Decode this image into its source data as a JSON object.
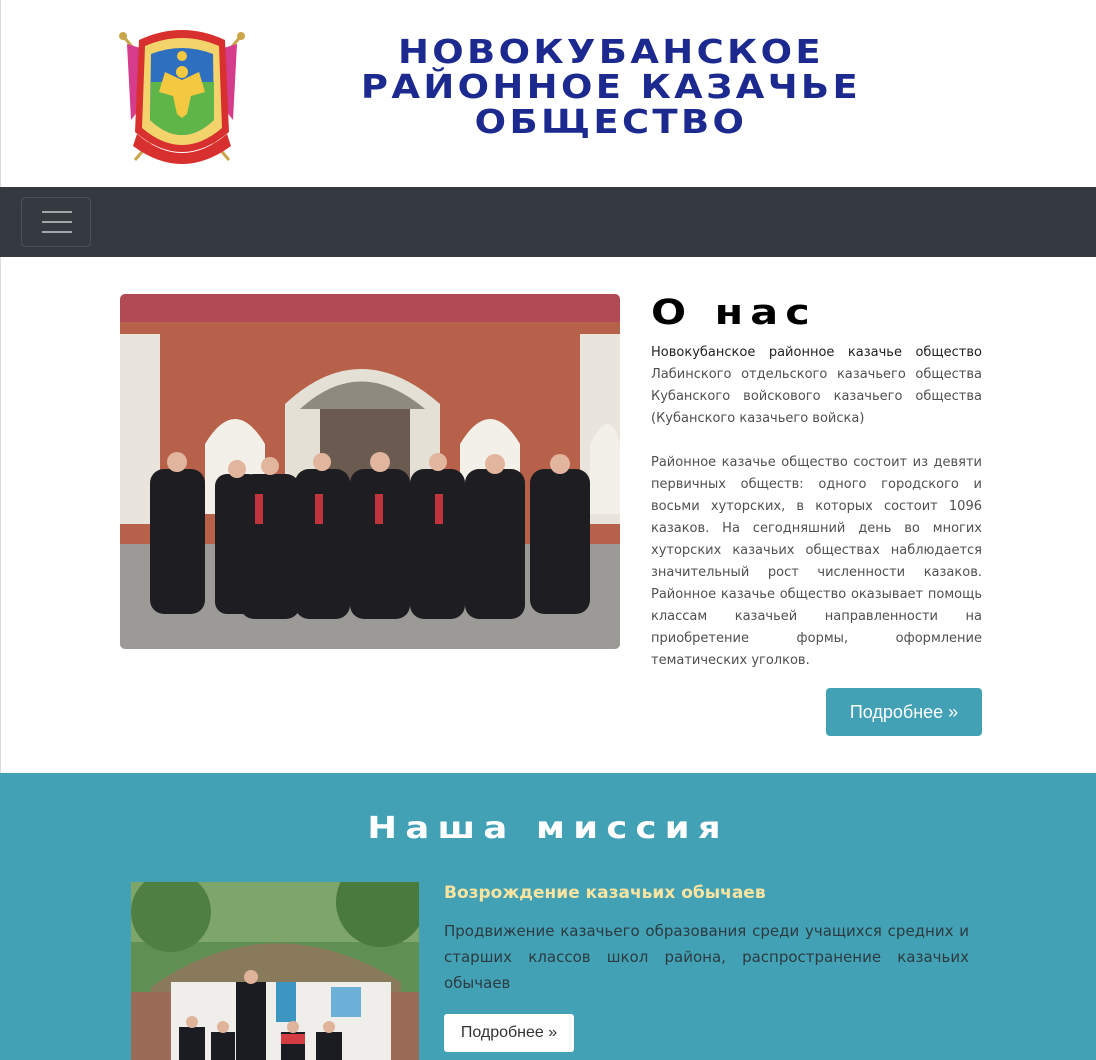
{
  "header": {
    "emblem": "coat-of-arms-emblem",
    "title_lines": [
      "НОВОКУБАНСКОЕ",
      "РАЙОННОЕ КАЗАЧЬЕ",
      "ОБЩЕСТВО"
    ]
  },
  "navbar": {
    "toggle_icon": "hamburger-menu-icon"
  },
  "about": {
    "title": "О нас",
    "intro_bold": "Новокубанское районное казачье общество",
    "intro_rest": " Лабинского отдельского казачьего общества Кубанского войскового казачьего общества (Кубанского казачьего войска)",
    "paragraph2": "Районное казачье общество состоит из девяти первичных обществ: одного городского и восьми хуторских, в которых состоит 1096 казаков. На сегодняшний день во многих хуторских казачьих обществах наблюдается значительный рост численности казаков. Районное казачье общество оказывает помощь классам казачьей направленности на приобретение формы, оформление тематических уголков.",
    "button_label": "Подробнее »"
  },
  "mission": {
    "title": "Наша миссия",
    "item_title": "Возрождение казачьих обычаев",
    "item_text": "Продвижение казачьего образования среди учащихся средних и старших классов школ района, распространение казачьих обычаев",
    "button_label": "Подробнее »"
  },
  "colors": {
    "title_blue": "#1c2a90",
    "navbar_bg": "#343a40",
    "accent_teal": "#43a1b6",
    "mission_subtitle": "#fbe3a0"
  }
}
